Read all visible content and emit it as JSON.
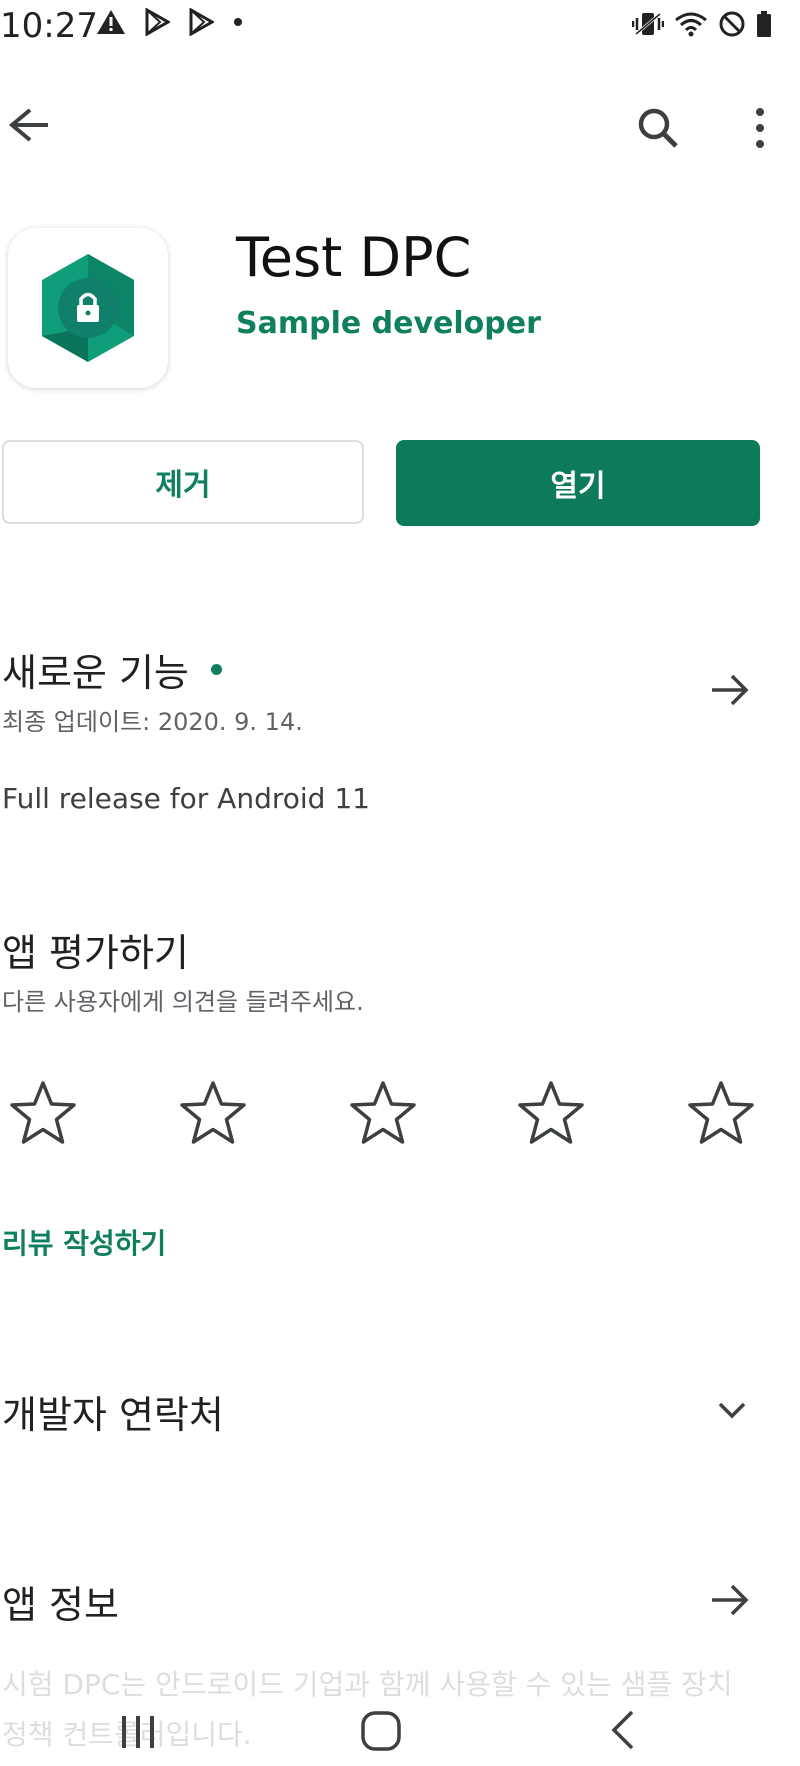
{
  "status_bar": {
    "time": "10:27",
    "left_icons": [
      "warning-icon",
      "play-store-icon",
      "play-store-icon",
      "dot-icon"
    ],
    "right_icons": [
      "vibrate-icon",
      "wifi-icon",
      "do-not-disturb-icon",
      "battery-icon"
    ]
  },
  "toolbar": {
    "back_icon": "arrow-back-icon",
    "search_icon": "search-icon",
    "more_icon": "more-vert-icon"
  },
  "app": {
    "title": "Test DPC",
    "developer": "Sample developer",
    "icon": "lock-hexagon-icon"
  },
  "buttons": {
    "remove_label": "제거",
    "open_label": "열기"
  },
  "whats_new": {
    "title": "새로운 기능",
    "last_updated": "최종 업데이트: 2020. 9. 14.",
    "body": "Full release for Android 11"
  },
  "rate_app": {
    "title": "앱 평가하기",
    "subtitle": "다른 사용자에게 의견을 들려주세요.",
    "stars": 5,
    "write_review_label": "리뷰 작성하기"
  },
  "developer_contact": {
    "title": "개발자 연락처"
  },
  "app_info": {
    "title": "앱 정보",
    "description": "시험 DPC는 안드로이드 기업과 함께 사용할 수 있는 샘플 장치 정책 컨트롤러입니다."
  },
  "colors": {
    "accent": "#0d7a5a",
    "accent_text": "#0f7f5e",
    "text_primary": "#202124",
    "text_secondary": "#5f6368"
  }
}
